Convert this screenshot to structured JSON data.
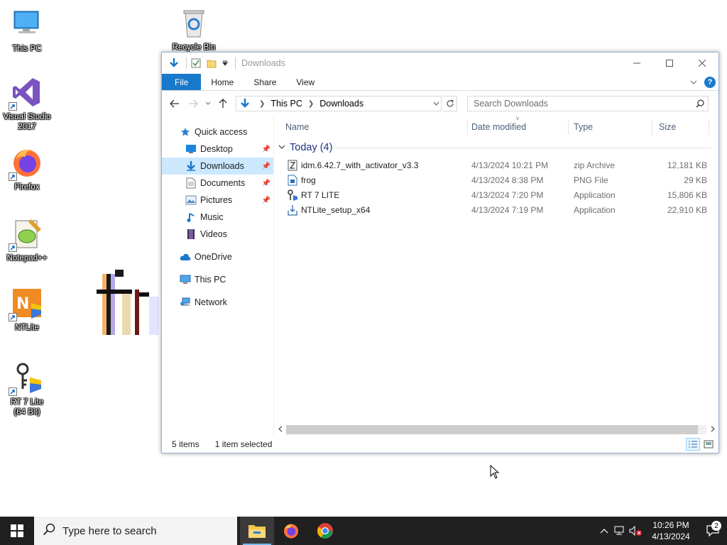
{
  "desktop": {
    "icons": [
      {
        "label": "This PC",
        "icon": "computer-icon"
      },
      {
        "label": "Recycle Bin",
        "icon": "recycle-bin-icon"
      },
      {
        "label": "Visual Studio 2017",
        "icon": "visual-studio-icon"
      },
      {
        "label": "Firefox",
        "icon": "firefox-icon"
      },
      {
        "label": "Notepad++",
        "icon": "notepad-plus-plus-icon"
      },
      {
        "label": "NTLite",
        "icon": "ntlite-icon"
      },
      {
        "label": "RT 7 Lite (64 Bit)",
        "icon": "rt7lite-icon"
      }
    ]
  },
  "explorer": {
    "title": "Downloads",
    "ribbon_tabs": {
      "file": "File",
      "home": "Home",
      "share": "Share",
      "view": "View"
    },
    "address": {
      "root": "This PC",
      "current": "Downloads"
    },
    "search_placeholder": "Search Downloads",
    "sidebar": {
      "quick_access": "Quick access",
      "desktop": "Desktop",
      "downloads": "Downloads",
      "documents": "Documents",
      "pictures": "Pictures",
      "music": "Music",
      "videos": "Videos",
      "onedrive": "OneDrive",
      "this_pc": "This PC",
      "network": "Network"
    },
    "columns": {
      "name": "Name",
      "date": "Date modified",
      "type": "Type",
      "size": "Size"
    },
    "group_label": "Today (4)",
    "files": [
      {
        "name": "idm.6.42.7_with_activator_v3.3",
        "date": "4/13/2024 10:21 PM",
        "type": "zip Archive",
        "size": "12,181 KB",
        "icon": "zip-file-icon"
      },
      {
        "name": "frog",
        "date": "4/13/2024 8:38 PM",
        "type": "PNG File",
        "size": "29 KB",
        "icon": "image-file-icon"
      },
      {
        "name": "RT 7 LITE",
        "date": "4/13/2024 7:20 PM",
        "type": "Application",
        "size": "15,806 KB",
        "icon": "application-icon"
      },
      {
        "name": "NTLite_setup_x64",
        "date": "4/13/2024 7:19 PM",
        "type": "Application",
        "size": "22,910 KB",
        "icon": "installer-icon"
      }
    ],
    "status": {
      "items": "5 items",
      "selected": "1 item selected"
    }
  },
  "taskbar": {
    "search_placeholder": "Type here to search",
    "apps": [
      "file-explorer-icon",
      "firefox-icon",
      "chrome-icon"
    ],
    "clock": {
      "time": "10:26 PM",
      "date": "4/13/2024"
    },
    "notification_count": "2"
  },
  "colors": {
    "accent": "#1979ca",
    "selection": "#cce8ff",
    "taskbar": "#202020"
  }
}
